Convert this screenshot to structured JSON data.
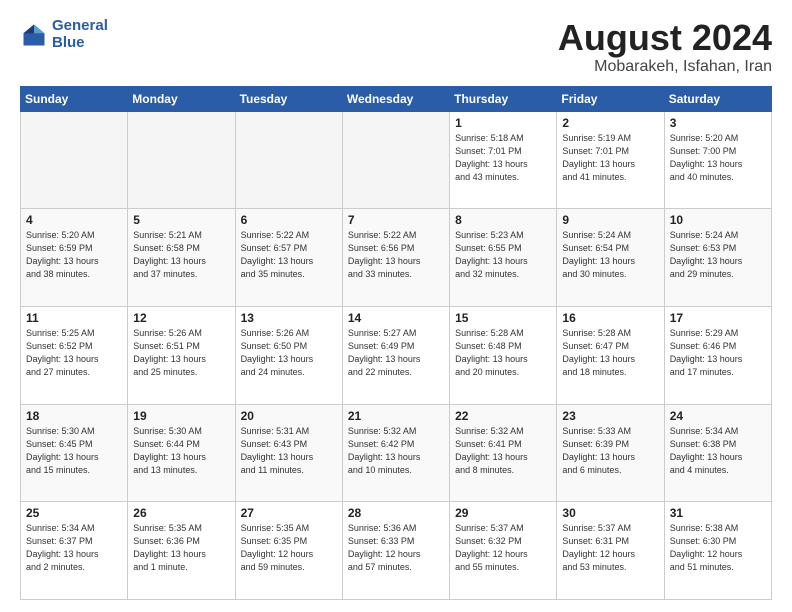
{
  "header": {
    "logo_line1": "General",
    "logo_line2": "Blue",
    "title": "August 2024",
    "subtitle": "Mobarakeh, Isfahan, Iran"
  },
  "weekdays": [
    "Sunday",
    "Monday",
    "Tuesday",
    "Wednesday",
    "Thursday",
    "Friday",
    "Saturday"
  ],
  "weeks": [
    [
      {
        "num": "",
        "info": ""
      },
      {
        "num": "",
        "info": ""
      },
      {
        "num": "",
        "info": ""
      },
      {
        "num": "",
        "info": ""
      },
      {
        "num": "1",
        "info": "Sunrise: 5:18 AM\nSunset: 7:01 PM\nDaylight: 13 hours\nand 43 minutes."
      },
      {
        "num": "2",
        "info": "Sunrise: 5:19 AM\nSunset: 7:01 PM\nDaylight: 13 hours\nand 41 minutes."
      },
      {
        "num": "3",
        "info": "Sunrise: 5:20 AM\nSunset: 7:00 PM\nDaylight: 13 hours\nand 40 minutes."
      }
    ],
    [
      {
        "num": "4",
        "info": "Sunrise: 5:20 AM\nSunset: 6:59 PM\nDaylight: 13 hours\nand 38 minutes."
      },
      {
        "num": "5",
        "info": "Sunrise: 5:21 AM\nSunset: 6:58 PM\nDaylight: 13 hours\nand 37 minutes."
      },
      {
        "num": "6",
        "info": "Sunrise: 5:22 AM\nSunset: 6:57 PM\nDaylight: 13 hours\nand 35 minutes."
      },
      {
        "num": "7",
        "info": "Sunrise: 5:22 AM\nSunset: 6:56 PM\nDaylight: 13 hours\nand 33 minutes."
      },
      {
        "num": "8",
        "info": "Sunrise: 5:23 AM\nSunset: 6:55 PM\nDaylight: 13 hours\nand 32 minutes."
      },
      {
        "num": "9",
        "info": "Sunrise: 5:24 AM\nSunset: 6:54 PM\nDaylight: 13 hours\nand 30 minutes."
      },
      {
        "num": "10",
        "info": "Sunrise: 5:24 AM\nSunset: 6:53 PM\nDaylight: 13 hours\nand 29 minutes."
      }
    ],
    [
      {
        "num": "11",
        "info": "Sunrise: 5:25 AM\nSunset: 6:52 PM\nDaylight: 13 hours\nand 27 minutes."
      },
      {
        "num": "12",
        "info": "Sunrise: 5:26 AM\nSunset: 6:51 PM\nDaylight: 13 hours\nand 25 minutes."
      },
      {
        "num": "13",
        "info": "Sunrise: 5:26 AM\nSunset: 6:50 PM\nDaylight: 13 hours\nand 24 minutes."
      },
      {
        "num": "14",
        "info": "Sunrise: 5:27 AM\nSunset: 6:49 PM\nDaylight: 13 hours\nand 22 minutes."
      },
      {
        "num": "15",
        "info": "Sunrise: 5:28 AM\nSunset: 6:48 PM\nDaylight: 13 hours\nand 20 minutes."
      },
      {
        "num": "16",
        "info": "Sunrise: 5:28 AM\nSunset: 6:47 PM\nDaylight: 13 hours\nand 18 minutes."
      },
      {
        "num": "17",
        "info": "Sunrise: 5:29 AM\nSunset: 6:46 PM\nDaylight: 13 hours\nand 17 minutes."
      }
    ],
    [
      {
        "num": "18",
        "info": "Sunrise: 5:30 AM\nSunset: 6:45 PM\nDaylight: 13 hours\nand 15 minutes."
      },
      {
        "num": "19",
        "info": "Sunrise: 5:30 AM\nSunset: 6:44 PM\nDaylight: 13 hours\nand 13 minutes."
      },
      {
        "num": "20",
        "info": "Sunrise: 5:31 AM\nSunset: 6:43 PM\nDaylight: 13 hours\nand 11 minutes."
      },
      {
        "num": "21",
        "info": "Sunrise: 5:32 AM\nSunset: 6:42 PM\nDaylight: 13 hours\nand 10 minutes."
      },
      {
        "num": "22",
        "info": "Sunrise: 5:32 AM\nSunset: 6:41 PM\nDaylight: 13 hours\nand 8 minutes."
      },
      {
        "num": "23",
        "info": "Sunrise: 5:33 AM\nSunset: 6:39 PM\nDaylight: 13 hours\nand 6 minutes."
      },
      {
        "num": "24",
        "info": "Sunrise: 5:34 AM\nSunset: 6:38 PM\nDaylight: 13 hours\nand 4 minutes."
      }
    ],
    [
      {
        "num": "25",
        "info": "Sunrise: 5:34 AM\nSunset: 6:37 PM\nDaylight: 13 hours\nand 2 minutes."
      },
      {
        "num": "26",
        "info": "Sunrise: 5:35 AM\nSunset: 6:36 PM\nDaylight: 13 hours\nand 1 minute."
      },
      {
        "num": "27",
        "info": "Sunrise: 5:35 AM\nSunset: 6:35 PM\nDaylight: 12 hours\nand 59 minutes."
      },
      {
        "num": "28",
        "info": "Sunrise: 5:36 AM\nSunset: 6:33 PM\nDaylight: 12 hours\nand 57 minutes."
      },
      {
        "num": "29",
        "info": "Sunrise: 5:37 AM\nSunset: 6:32 PM\nDaylight: 12 hours\nand 55 minutes."
      },
      {
        "num": "30",
        "info": "Sunrise: 5:37 AM\nSunset: 6:31 PM\nDaylight: 12 hours\nand 53 minutes."
      },
      {
        "num": "31",
        "info": "Sunrise: 5:38 AM\nSunset: 6:30 PM\nDaylight: 12 hours\nand 51 minutes."
      }
    ]
  ]
}
